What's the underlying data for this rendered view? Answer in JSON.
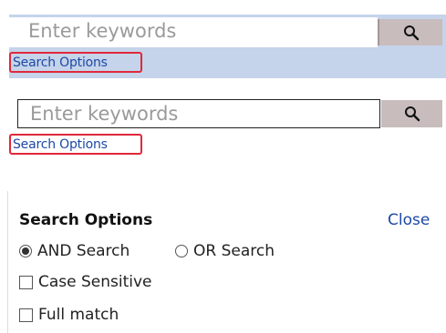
{
  "search_bar_1": {
    "placeholder": "Enter keywords",
    "options_link": "Search Options",
    "button_icon": "search-icon",
    "band_color": "#c5d4ea"
  },
  "search_bar_2": {
    "placeholder": "Enter keywords",
    "options_link": "Search Options",
    "button_icon": "search-icon"
  },
  "options_panel": {
    "title": "Search Options",
    "close_label": "Close",
    "radios": [
      {
        "label": "AND Search",
        "selected": true
      },
      {
        "label": "OR Search",
        "selected": false
      }
    ],
    "checkboxes": [
      {
        "label": "Case Sensitive",
        "checked": false
      },
      {
        "label": "Full match",
        "checked": false
      }
    ]
  },
  "colors": {
    "link": "#1d49a5",
    "highlight_border": "#e0283a",
    "button_bg": "#c8bcbc"
  }
}
